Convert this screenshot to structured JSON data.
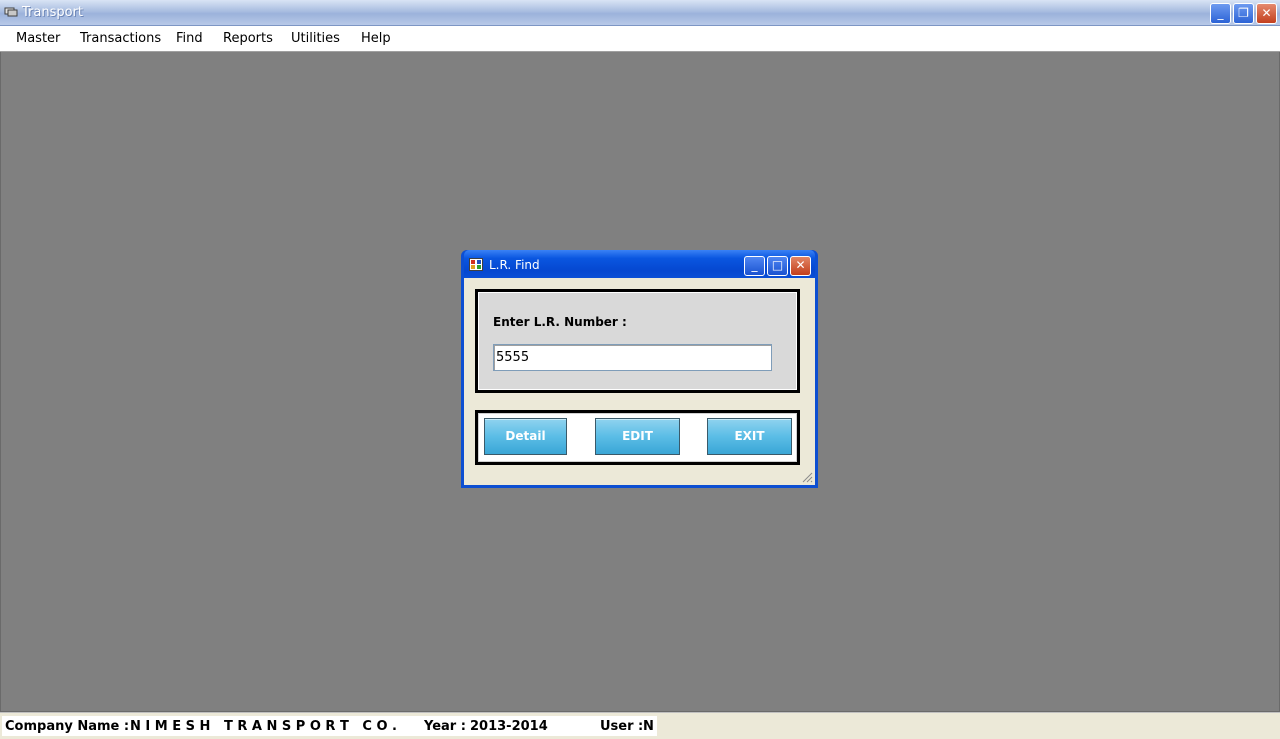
{
  "window": {
    "title": "Transport",
    "buttons": {
      "minimize": "_",
      "restore": "❐",
      "close": "✕"
    }
  },
  "menu": {
    "items": [
      "Master",
      "Transactions",
      "Find",
      "Reports",
      "Utilities",
      "Help"
    ]
  },
  "dialog": {
    "title": "L.R. Find",
    "label": "Enter L.R. Number :",
    "lr_number_value": "5555",
    "buttons": {
      "detail": "Detail",
      "edit": "EDIT",
      "exit": "EXIT"
    },
    "window_buttons": {
      "minimize": "_",
      "maximize": "□",
      "close": "✕"
    }
  },
  "status": {
    "company_label": "Company Name :",
    "company_value": "N I M E S H   T R A N S P O R T   C O .",
    "year_label": "Year :",
    "year_value": "2013-2014",
    "user_label": "User :",
    "user_value": "N"
  },
  "colors": {
    "titlebar_blue": "#0a56e0",
    "button_cyan": "#5bbde6",
    "mdi_background": "#808080"
  }
}
